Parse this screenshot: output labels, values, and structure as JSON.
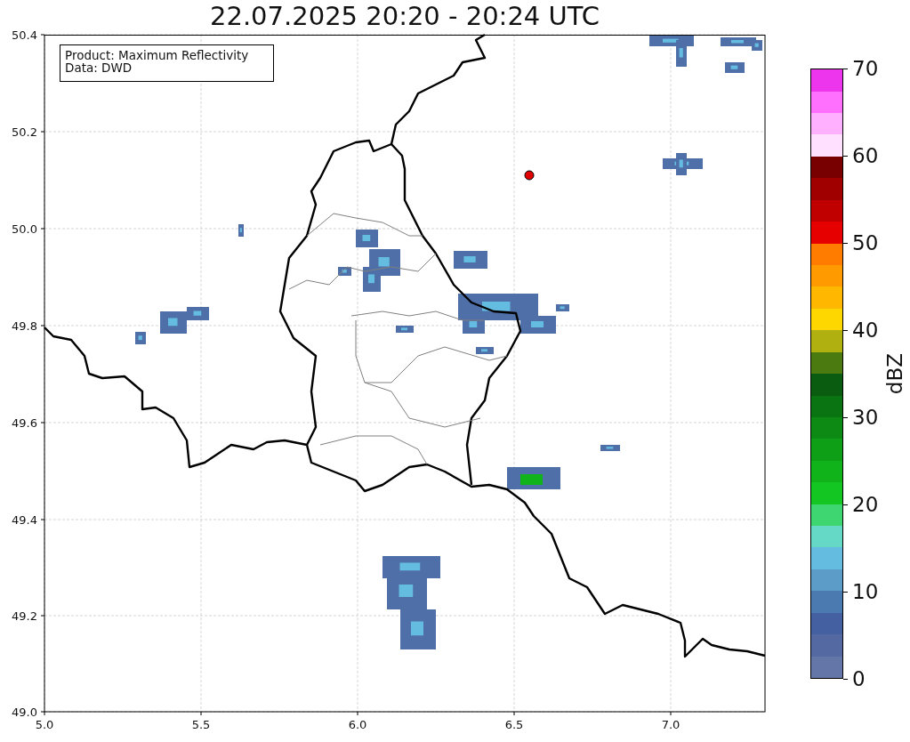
{
  "title": "22.07.2025 20:20 - 20:24 UTC",
  "map": {
    "legend": [
      "Product: Maximum Reflectivity",
      "Data: DWD"
    ],
    "x_tick_labels": [
      "5.0",
      "5.5",
      "6.0",
      "6.5",
      "7.0"
    ],
    "y_tick_labels": [
      "50.4",
      "50.2",
      "50.0",
      "49.8",
      "49.6",
      "49.4",
      "49.2",
      "49.0"
    ]
  },
  "colorbar": {
    "label": "dBZ",
    "tick_labels": [
      "70",
      "60",
      "50",
      "40",
      "30",
      "20",
      "10",
      "0"
    ],
    "bands": [
      {
        "color": "#6475a7"
      },
      {
        "color": "#5468a2"
      },
      {
        "color": "#4560a0"
      },
      {
        "color": "#4a7ab0"
      },
      {
        "color": "#5b9cc8"
      },
      {
        "color": "#64bde0"
      },
      {
        "color": "#65d8c6"
      },
      {
        "color": "#3ed671"
      },
      {
        "color": "#13c622"
      },
      {
        "color": "#10b31a"
      },
      {
        "color": "#0e9f16"
      },
      {
        "color": "#0c8a14"
      },
      {
        "color": "#0b7412"
      },
      {
        "color": "#0a5d10"
      },
      {
        "color": "#4a7a10"
      },
      {
        "color": "#b0b010"
      },
      {
        "color": "#ffd700"
      },
      {
        "color": "#ffb700"
      },
      {
        "color": "#ff9a00"
      },
      {
        "color": "#ff7c00"
      },
      {
        "color": "#e60000"
      },
      {
        "color": "#c00000"
      },
      {
        "color": "#a00000"
      },
      {
        "color": "#780000"
      },
      {
        "color": "#ffe0ff"
      },
      {
        "color": "#ffb0ff"
      },
      {
        "color": "#ff70ff"
      },
      {
        "color": "#ee35ee"
      }
    ]
  }
}
